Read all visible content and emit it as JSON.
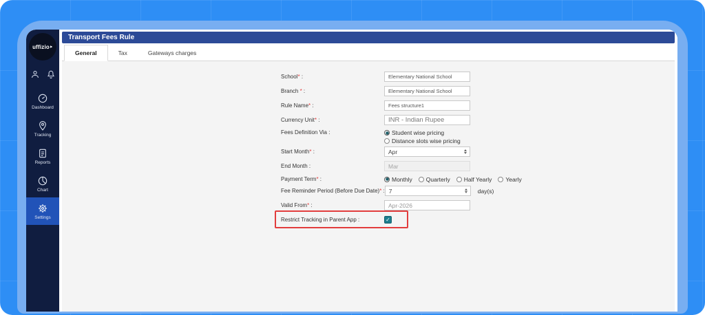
{
  "brand": {
    "logo_text": "uffizio‣"
  },
  "sidebar": {
    "items": [
      {
        "id": "dashboard",
        "label": "Dashboard",
        "active": false
      },
      {
        "id": "tracking",
        "label": "Tracking",
        "active": false
      },
      {
        "id": "reports",
        "label": "Reports",
        "active": false
      },
      {
        "id": "chart",
        "label": "Chart",
        "active": false
      },
      {
        "id": "settings",
        "label": "Settings",
        "active": true
      }
    ]
  },
  "titlebar": {
    "title": "Transport Fees Rule"
  },
  "tabs": [
    {
      "label": "General",
      "active": true
    },
    {
      "label": "Tax",
      "active": false
    },
    {
      "label": "Gateways charges",
      "active": false
    }
  ],
  "form": {
    "required_mark": "*",
    "colon": " :",
    "school": {
      "label": "School",
      "value": "Elementary National School"
    },
    "branch": {
      "label": "Branch ",
      "value": "Elementary National School"
    },
    "rule_name": {
      "label": "Rule Name",
      "value": "Fees structure1"
    },
    "currency": {
      "label": "Currency Unit",
      "value": "INR - Indian Rupee"
    },
    "fees_def": {
      "label": "Fees Definition Via",
      "options": [
        "Student wise pricing",
        "Distance slots wise pricing"
      ],
      "selected": "Student wise pricing"
    },
    "start_month": {
      "label": "Start Month",
      "value": "Apr"
    },
    "end_month": {
      "label": "End Month",
      "value": "Mar",
      "disabled": true
    },
    "payment_term": {
      "label": "Payment Term",
      "options": [
        "Monthly",
        "Quarterly",
        "Half Yearly",
        "Yearly"
      ],
      "selected": "Monthly"
    },
    "fee_reminder": {
      "label": "Fee Reminder Period (Before Due Date)",
      "value": "7",
      "suffix": "day(s)"
    },
    "valid_from": {
      "label": "Valid From",
      "value": "Apr-2026"
    },
    "restrict_tracking": {
      "label": "Restrict Tracking in Parent App",
      "checked": true
    }
  },
  "colors": {
    "background_blue": "#2e8ef5",
    "card_blue": "#78aef1",
    "sidebar_navy": "#101d40",
    "titlebar_blue": "#2c4a97",
    "active_nav_blue": "#2153b8",
    "checkbox_teal": "#1d7e8f",
    "highlight_red": "#e23c3c"
  }
}
